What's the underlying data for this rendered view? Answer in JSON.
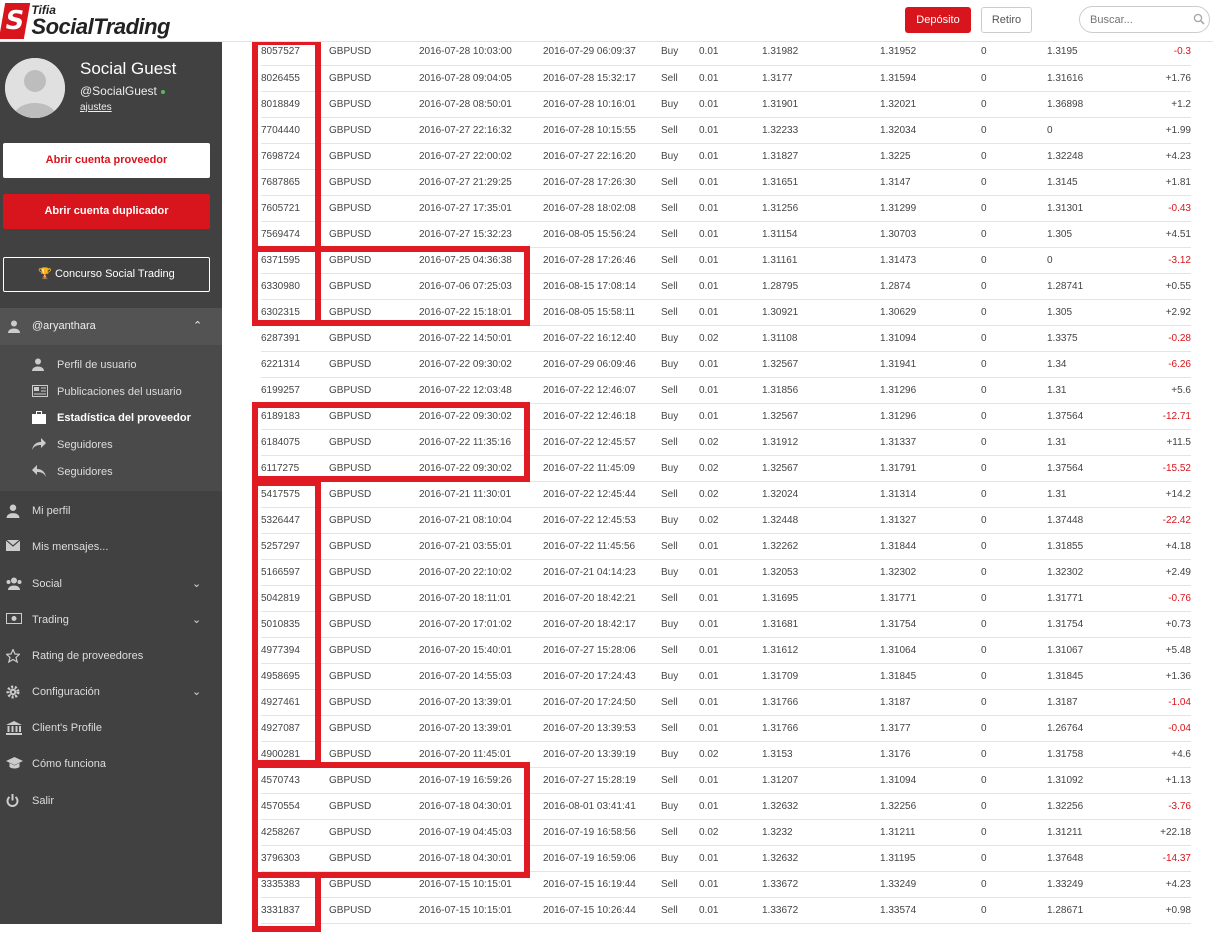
{
  "brand": {
    "small": "Tifia",
    "big": "SocialTrading"
  },
  "header": {
    "deposit": "Depósito",
    "withdraw": "Retiro",
    "search_placeholder": "Buscar..."
  },
  "user": {
    "name": "Social Guest",
    "handle": "@SocialGuest",
    "settings": "ajustes"
  },
  "sidebar": {
    "btn_provider": "Abrir cuenta proveedor",
    "btn_copier": "Abrir cuenta duplicador",
    "btn_contest": "Concurso Social Trading",
    "account": "@aryanthara",
    "submenu": [
      {
        "label": "Perfil de usuario",
        "icon": "user-icon"
      },
      {
        "label": "Publicaciones del usuario",
        "icon": "newspaper-icon"
      },
      {
        "label": "Estadística del proveedor",
        "icon": "briefcase-icon",
        "active": true
      },
      {
        "label": "Seguidores",
        "icon": "share-icon"
      },
      {
        "label": "Seguidores",
        "icon": "reply-icon"
      }
    ],
    "menu": [
      {
        "label": "Mi perfil",
        "icon": "user-icon",
        "chevron": false
      },
      {
        "label": "Mis mensajes...",
        "icon": "envelope-icon",
        "chevron": false
      },
      {
        "label": "Social",
        "icon": "users-icon",
        "chevron": true
      },
      {
        "label": "Trading",
        "icon": "money-icon",
        "chevron": true
      },
      {
        "label": "Rating de proveedores",
        "icon": "star-icon",
        "chevron": false
      },
      {
        "label": "Configuración",
        "icon": "gear-icon",
        "chevron": true
      },
      {
        "label": "Client's Profile",
        "icon": "bank-icon",
        "chevron": false
      },
      {
        "label": "Cómo funciona",
        "icon": "graduation-cap-icon",
        "chevron": false
      },
      {
        "label": "Salir",
        "icon": "power-icon",
        "chevron": false
      }
    ]
  },
  "trades": [
    [
      "8057527",
      "GBPUSD",
      "2016-07-28 10:03:00",
      "2016-07-29 06:09:37",
      "Buy",
      "0.01",
      "1.31982",
      "1.31952",
      "0",
      "1.3195",
      "-0.3"
    ],
    [
      "8026455",
      "GBPUSD",
      "2016-07-28 09:04:05",
      "2016-07-28 15:32:17",
      "Sell",
      "0.01",
      "1.3177",
      "1.31594",
      "0",
      "1.31616",
      "+1.76"
    ],
    [
      "8018849",
      "GBPUSD",
      "2016-07-28 08:50:01",
      "2016-07-28 10:16:01",
      "Buy",
      "0.01",
      "1.31901",
      "1.32021",
      "0",
      "1.36898",
      "+1.2"
    ],
    [
      "7704440",
      "GBPUSD",
      "2016-07-27 22:16:32",
      "2016-07-28 10:15:55",
      "Sell",
      "0.01",
      "1.32233",
      "1.32034",
      "0",
      "0",
      "+1.99"
    ],
    [
      "7698724",
      "GBPUSD",
      "2016-07-27 22:00:02",
      "2016-07-27 22:16:20",
      "Buy",
      "0.01",
      "1.31827",
      "1.3225",
      "0",
      "1.32248",
      "+4.23"
    ],
    [
      "7687865",
      "GBPUSD",
      "2016-07-27 21:29:25",
      "2016-07-28 17:26:30",
      "Sell",
      "0.01",
      "1.31651",
      "1.3147",
      "0",
      "1.3145",
      "+1.81"
    ],
    [
      "7605721",
      "GBPUSD",
      "2016-07-27 17:35:01",
      "2016-07-28 18:02:08",
      "Sell",
      "0.01",
      "1.31256",
      "1.31299",
      "0",
      "1.31301",
      "-0.43"
    ],
    [
      "7569474",
      "GBPUSD",
      "2016-07-27 15:32:23",
      "2016-08-05 15:56:24",
      "Sell",
      "0.01",
      "1.31154",
      "1.30703",
      "0",
      "1.305",
      "+4.51"
    ],
    [
      "6371595",
      "GBPUSD",
      "2016-07-25 04:36:38",
      "2016-07-28 17:26:46",
      "Sell",
      "0.01",
      "1.31161",
      "1.31473",
      "0",
      "0",
      "-3.12"
    ],
    [
      "6330980",
      "GBPUSD",
      "2016-07-06 07:25:03",
      "2016-08-15 17:08:14",
      "Sell",
      "0.01",
      "1.28795",
      "1.2874",
      "0",
      "1.28741",
      "+0.55"
    ],
    [
      "6302315",
      "GBPUSD",
      "2016-07-22 15:18:01",
      "2016-08-05 15:58:11",
      "Sell",
      "0.01",
      "1.30921",
      "1.30629",
      "0",
      "1.305",
      "+2.92"
    ],
    [
      "6287391",
      "GBPUSD",
      "2016-07-22 14:50:01",
      "2016-07-22 16:12:40",
      "Buy",
      "0.02",
      "1.31108",
      "1.31094",
      "0",
      "1.3375",
      "-0.28"
    ],
    [
      "6221314",
      "GBPUSD",
      "2016-07-22 09:30:02",
      "2016-07-29 06:09:46",
      "Buy",
      "0.01",
      "1.32567",
      "1.31941",
      "0",
      "1.34",
      "-6.26"
    ],
    [
      "6199257",
      "GBPUSD",
      "2016-07-22 12:03:48",
      "2016-07-22 12:46:07",
      "Sell",
      "0.01",
      "1.31856",
      "1.31296",
      "0",
      "1.31",
      "+5.6"
    ],
    [
      "6189183",
      "GBPUSD",
      "2016-07-22 09:30:02",
      "2016-07-22 12:46:18",
      "Buy",
      "0.01",
      "1.32567",
      "1.31296",
      "0",
      "1.37564",
      "-12.71"
    ],
    [
      "6184075",
      "GBPUSD",
      "2016-07-22 11:35:16",
      "2016-07-22 12:45:57",
      "Sell",
      "0.02",
      "1.31912",
      "1.31337",
      "0",
      "1.31",
      "+11.5"
    ],
    [
      "6117275",
      "GBPUSD",
      "2016-07-22 09:30:02",
      "2016-07-22 11:45:09",
      "Buy",
      "0.02",
      "1.32567",
      "1.31791",
      "0",
      "1.37564",
      "-15.52"
    ],
    [
      "5417575",
      "GBPUSD",
      "2016-07-21 11:30:01",
      "2016-07-22 12:45:44",
      "Sell",
      "0.02",
      "1.32024",
      "1.31314",
      "0",
      "1.31",
      "+14.2"
    ],
    [
      "5326447",
      "GBPUSD",
      "2016-07-21 08:10:04",
      "2016-07-22 12:45:53",
      "Buy",
      "0.02",
      "1.32448",
      "1.31327",
      "0",
      "1.37448",
      "-22.42"
    ],
    [
      "5257297",
      "GBPUSD",
      "2016-07-21 03:55:01",
      "2016-07-22 11:45:56",
      "Sell",
      "0.01",
      "1.32262",
      "1.31844",
      "0",
      "1.31855",
      "+4.18"
    ],
    [
      "5166597",
      "GBPUSD",
      "2016-07-20 22:10:02",
      "2016-07-21 04:14:23",
      "Buy",
      "0.01",
      "1.32053",
      "1.32302",
      "0",
      "1.32302",
      "+2.49"
    ],
    [
      "5042819",
      "GBPUSD",
      "2016-07-20 18:11:01",
      "2016-07-20 18:42:21",
      "Sell",
      "0.01",
      "1.31695",
      "1.31771",
      "0",
      "1.31771",
      "-0.76"
    ],
    [
      "5010835",
      "GBPUSD",
      "2016-07-20 17:01:02",
      "2016-07-20 18:42:17",
      "Buy",
      "0.01",
      "1.31681",
      "1.31754",
      "0",
      "1.31754",
      "+0.73"
    ],
    [
      "4977394",
      "GBPUSD",
      "2016-07-20 15:40:01",
      "2016-07-27 15:28:06",
      "Sell",
      "0.01",
      "1.31612",
      "1.31064",
      "0",
      "1.31067",
      "+5.48"
    ],
    [
      "4958695",
      "GBPUSD",
      "2016-07-20 14:55:03",
      "2016-07-20 17:24:43",
      "Buy",
      "0.01",
      "1.31709",
      "1.31845",
      "0",
      "1.31845",
      "+1.36"
    ],
    [
      "4927461",
      "GBPUSD",
      "2016-07-20 13:39:01",
      "2016-07-20 17:24:50",
      "Sell",
      "0.01",
      "1.31766",
      "1.3187",
      "0",
      "1.3187",
      "-1.04"
    ],
    [
      "4927087",
      "GBPUSD",
      "2016-07-20 13:39:01",
      "2016-07-20 13:39:53",
      "Sell",
      "0.01",
      "1.31766",
      "1.3177",
      "0",
      "1.26764",
      "-0.04"
    ],
    [
      "4900281",
      "GBPUSD",
      "2016-07-20 11:45:01",
      "2016-07-20 13:39:19",
      "Buy",
      "0.02",
      "1.3153",
      "1.3176",
      "0",
      "1.31758",
      "+4.6"
    ],
    [
      "4570743",
      "GBPUSD",
      "2016-07-19 16:59:26",
      "2016-07-27 15:28:19",
      "Sell",
      "0.01",
      "1.31207",
      "1.31094",
      "0",
      "1.31092",
      "+1.13"
    ],
    [
      "4570554",
      "GBPUSD",
      "2016-07-18 04:30:01",
      "2016-08-01 03:41:41",
      "Buy",
      "0.01",
      "1.32632",
      "1.32256",
      "0",
      "1.32256",
      "-3.76"
    ],
    [
      "4258267",
      "GBPUSD",
      "2016-07-19 04:45:03",
      "2016-07-19 16:58:56",
      "Sell",
      "0.02",
      "1.3232",
      "1.31211",
      "0",
      "1.31211",
      "+22.18"
    ],
    [
      "3796303",
      "GBPUSD",
      "2016-07-18 04:30:01",
      "2016-07-19 16:59:06",
      "Buy",
      "0.01",
      "1.32632",
      "1.31195",
      "0",
      "1.37648",
      "-14.37"
    ],
    [
      "3335383",
      "GBPUSD",
      "2016-07-15 10:15:01",
      "2016-07-15 16:19:44",
      "Sell",
      "0.01",
      "1.33672",
      "1.33249",
      "0",
      "1.33249",
      "+4.23"
    ],
    [
      "3331837",
      "GBPUSD",
      "2016-07-15 10:15:01",
      "2016-07-15 10:26:44",
      "Sell",
      "0.01",
      "1.33672",
      "1.33574",
      "0",
      "1.28671",
      "+0.98"
    ]
  ],
  "colors": {
    "accent": "#d8141c",
    "sidebar_bg": "#414141",
    "highlight": "#e01b24"
  }
}
